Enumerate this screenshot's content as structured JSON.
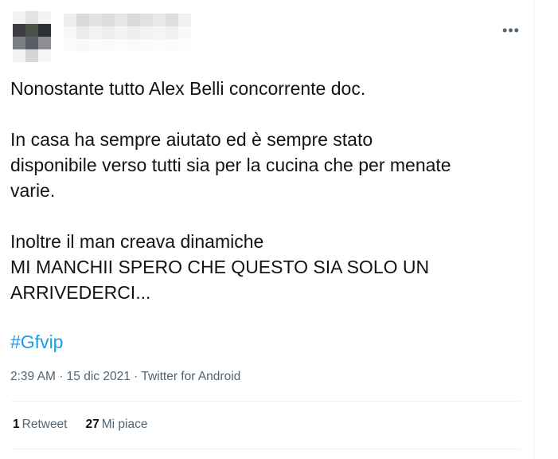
{
  "tweet": {
    "more_icon": "more-horizontal-icon",
    "more_glyph": "•••",
    "paragraphs": [
      "Nonostante tutto Alex Belli concorrente doc.",
      "In casa ha sempre aiutato ed è sempre stato\ndisponibile verso tutti sia per la cucina che per menate\nvarie.",
      "Inoltre il man creava dinamiche\nMI MANCHII SPERO CHE QUESTO SIA SOLO UN\nARRIVEDERCI..."
    ],
    "hashtag": "#Gfvip",
    "time": "2:39 AM",
    "separator": "·",
    "date": "15 dic 2021",
    "source": "Twitter for Android",
    "retweets_count": "1",
    "retweets_label": "Retweet",
    "likes_count": "27",
    "likes_label": "Mi piace"
  },
  "colors": {
    "text": "#0f1419",
    "secondary": "#536471",
    "accent": "#1d9bf0",
    "divider": "#eff3f4"
  }
}
